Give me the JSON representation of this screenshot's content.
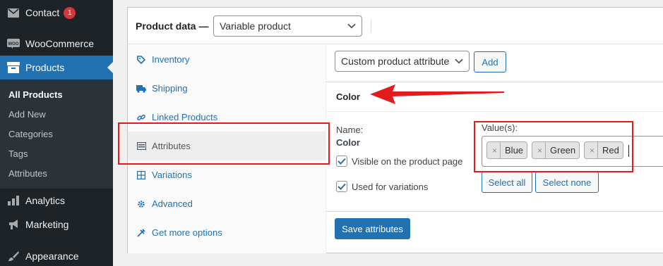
{
  "sidebar": {
    "items": [
      {
        "label": "Contact",
        "icon": "envelope-icon",
        "badge": "1"
      },
      {
        "label": "WooCommerce",
        "icon": "woo-icon"
      },
      {
        "label": "Products",
        "icon": "archive-icon",
        "active": true
      },
      {
        "label": "Analytics",
        "icon": "bar-chart-icon"
      },
      {
        "label": "Marketing",
        "icon": "megaphone-icon"
      },
      {
        "label": "Appearance",
        "icon": "paintbrush-icon"
      }
    ],
    "submenu": [
      "All Products",
      "Add New",
      "Categories",
      "Tags",
      "Attributes"
    ]
  },
  "product_data": {
    "label": "Product data —",
    "type_selected": "Variable product"
  },
  "tabs": [
    {
      "label": "Inventory",
      "icon": "tag-icon"
    },
    {
      "label": "Shipping",
      "icon": "truck-icon"
    },
    {
      "label": "Linked Products",
      "icon": "link-icon"
    },
    {
      "label": "Attributes",
      "icon": "list-icon",
      "active": true
    },
    {
      "label": "Variations",
      "icon": "grid-icon"
    },
    {
      "label": "Advanced",
      "icon": "gear-icon"
    },
    {
      "label": "Get more options",
      "icon": "plugin-icon"
    }
  ],
  "attributes": {
    "select_value": "Custom product attribute",
    "add_label": "Add",
    "attribute_title": "Color",
    "name_label": "Name:",
    "name_value": "Color",
    "visible_label": "Visible on the product page",
    "variations_label": "Used for variations",
    "values_label": "Value(s):",
    "values": [
      "Blue",
      "Green",
      "Red"
    ],
    "remove_glyph": "×",
    "select_all": "Select all",
    "select_none": "Select none",
    "save_label": "Save attributes"
  },
  "colors": {
    "accent": "#2271b1",
    "sidebar_bg": "#1d2327",
    "highlight": "#e31b1b",
    "badge": "#d63638"
  }
}
